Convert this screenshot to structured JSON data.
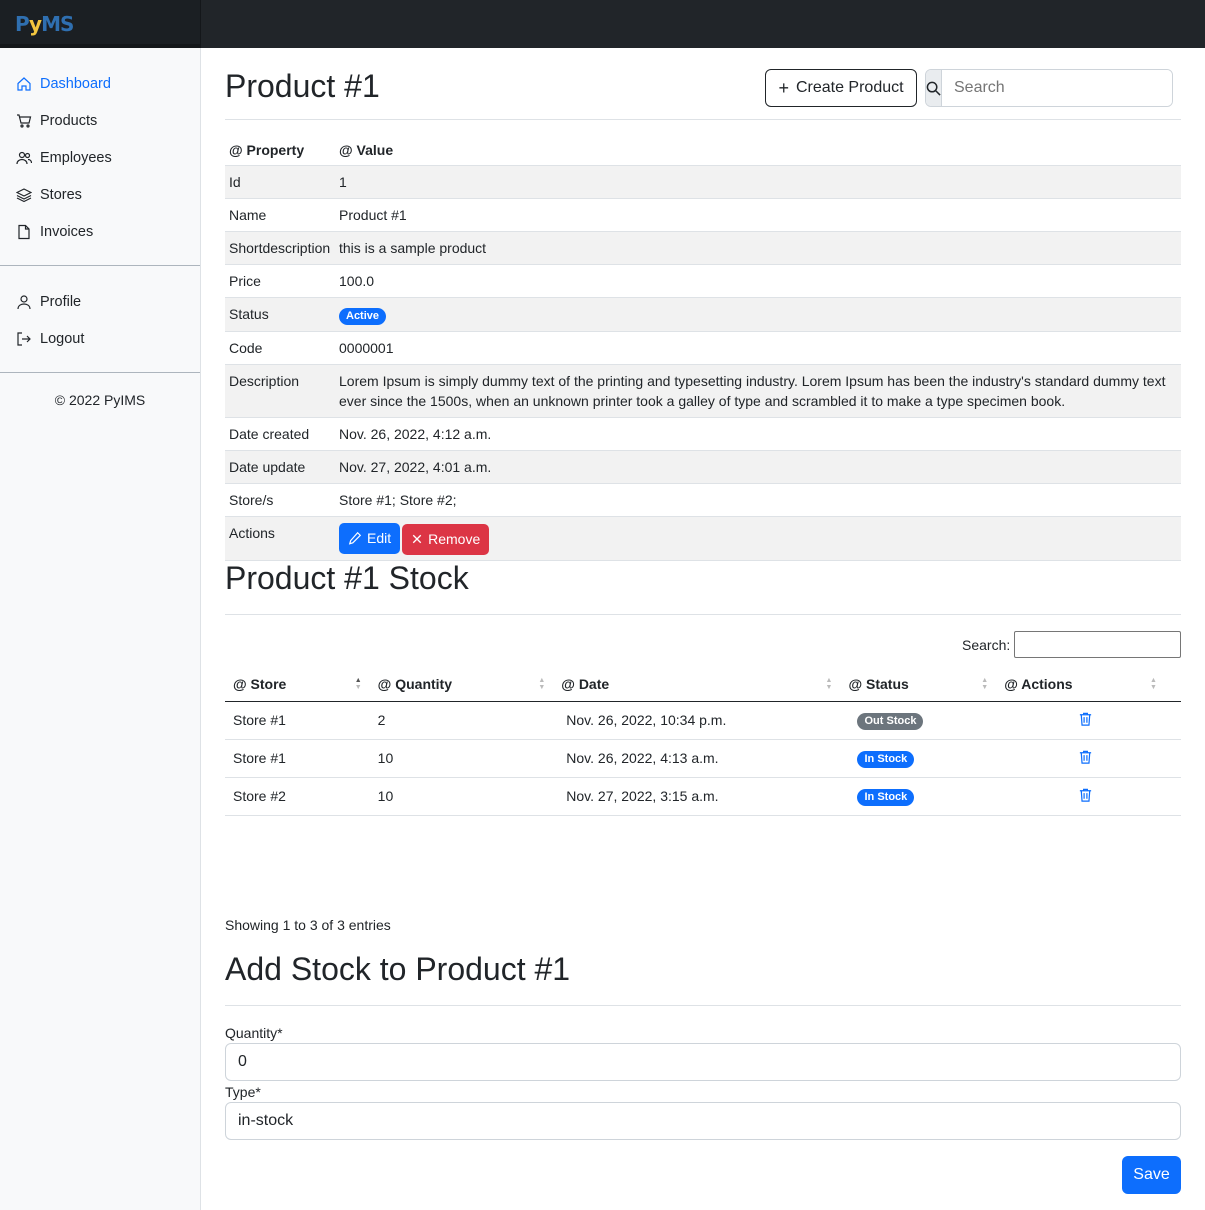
{
  "brand": {
    "part1": "P",
    "part2": "y",
    "part3": "MS"
  },
  "sidebar": {
    "items": [
      {
        "label": "Dashboard",
        "icon": "house-icon"
      },
      {
        "label": "Products",
        "icon": "cart-icon"
      },
      {
        "label": "Employees",
        "icon": "people-icon"
      },
      {
        "label": "Stores",
        "icon": "layers-icon"
      },
      {
        "label": "Invoices",
        "icon": "file-icon"
      }
    ],
    "secondary": [
      {
        "label": "Profile",
        "icon": "person-icon"
      },
      {
        "label": "Logout",
        "icon": "logout-icon"
      }
    ],
    "copyright": "© 2022 PyIMS"
  },
  "header": {
    "title": "Product #1",
    "create_label": "Create Product",
    "search_placeholder": "Search"
  },
  "properties": {
    "headers": [
      "@ Property",
      "@ Value"
    ],
    "rows": [
      {
        "key": "Id",
        "value": "1"
      },
      {
        "key": "Name",
        "value": "Product #1"
      },
      {
        "key": "Shortdescription",
        "value": "this is a sample product"
      },
      {
        "key": "Price",
        "value": "100.0"
      },
      {
        "key": "Status",
        "value": "Active"
      },
      {
        "key": "Code",
        "value": "0000001"
      },
      {
        "key": "Description",
        "value": "Lorem Ipsum is simply dummy text of the printing and typesetting industry. Lorem Ipsum has been the industry's standard dummy text ever since the 1500s, when an unknown printer took a galley of type and scrambled it to make a type specimen book."
      },
      {
        "key": "Date created",
        "value": "Nov. 26, 2022, 4:12 a.m."
      },
      {
        "key": "Date update",
        "value": "Nov. 27, 2022, 4:01 a.m."
      },
      {
        "key": "Store/s",
        "value": "Store #1; Store #2;"
      },
      {
        "key": "Actions",
        "edit_label": "Edit",
        "remove_label": "Remove"
      }
    ]
  },
  "stock": {
    "title": "Product #1 Stock",
    "search_label": "Search:",
    "headers": [
      "@ Store",
      "@ Quantity",
      "@ Date",
      "@ Status",
      "@ Actions"
    ],
    "rows": [
      {
        "store": "Store #1",
        "quantity": "2",
        "date": "Nov. 26, 2022, 10:34 p.m.",
        "status": "Out Stock"
      },
      {
        "store": "Store #1",
        "quantity": "10",
        "date": "Nov. 26, 2022, 4:13 a.m.",
        "status": "In Stock"
      },
      {
        "store": "Store #2",
        "quantity": "10",
        "date": "Nov. 27, 2022, 3:15 a.m.",
        "status": "In Stock"
      }
    ],
    "showing": "Showing 1 to 3 of 3 entries"
  },
  "add_stock": {
    "title": "Add Stock to Product #1",
    "quantity_label": "Quantity*",
    "quantity_value": "0",
    "type_label": "Type*",
    "type_value": "in-stock",
    "save_label": "Save"
  },
  "colors": {
    "primary": "#0d6efd",
    "danger": "#dc3545",
    "secondary": "#6c757d",
    "topbar": "#212529"
  }
}
